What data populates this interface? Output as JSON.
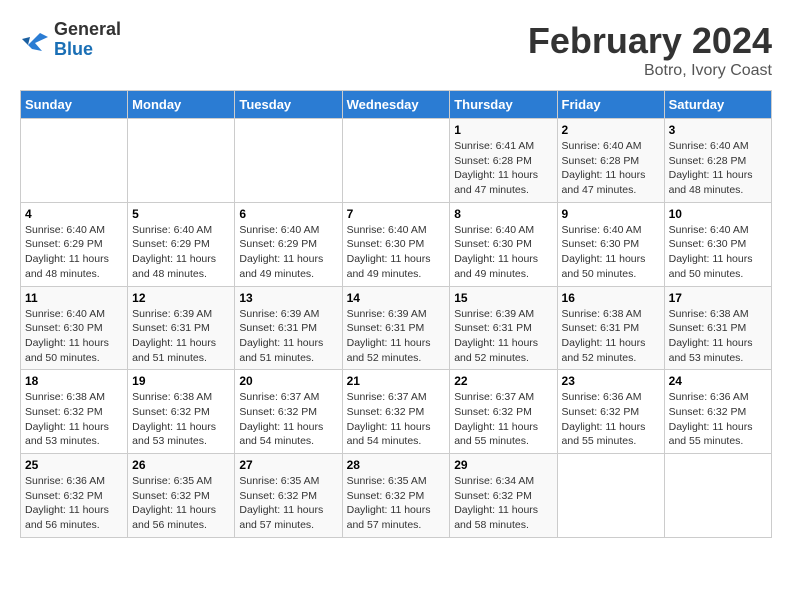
{
  "header": {
    "logo_general": "General",
    "logo_blue": "Blue",
    "title": "February 2024",
    "subtitle": "Botro, Ivory Coast"
  },
  "calendar": {
    "days_of_week": [
      "Sunday",
      "Monday",
      "Tuesday",
      "Wednesday",
      "Thursday",
      "Friday",
      "Saturday"
    ],
    "weeks": [
      [
        {
          "day": "",
          "info": ""
        },
        {
          "day": "",
          "info": ""
        },
        {
          "day": "",
          "info": ""
        },
        {
          "day": "",
          "info": ""
        },
        {
          "day": "1",
          "info": "Sunrise: 6:41 AM\nSunset: 6:28 PM\nDaylight: 11 hours and 47 minutes."
        },
        {
          "day": "2",
          "info": "Sunrise: 6:40 AM\nSunset: 6:28 PM\nDaylight: 11 hours and 47 minutes."
        },
        {
          "day": "3",
          "info": "Sunrise: 6:40 AM\nSunset: 6:28 PM\nDaylight: 11 hours and 48 minutes."
        }
      ],
      [
        {
          "day": "4",
          "info": "Sunrise: 6:40 AM\nSunset: 6:29 PM\nDaylight: 11 hours and 48 minutes."
        },
        {
          "day": "5",
          "info": "Sunrise: 6:40 AM\nSunset: 6:29 PM\nDaylight: 11 hours and 48 minutes."
        },
        {
          "day": "6",
          "info": "Sunrise: 6:40 AM\nSunset: 6:29 PM\nDaylight: 11 hours and 49 minutes."
        },
        {
          "day": "7",
          "info": "Sunrise: 6:40 AM\nSunset: 6:30 PM\nDaylight: 11 hours and 49 minutes."
        },
        {
          "day": "8",
          "info": "Sunrise: 6:40 AM\nSunset: 6:30 PM\nDaylight: 11 hours and 49 minutes."
        },
        {
          "day": "9",
          "info": "Sunrise: 6:40 AM\nSunset: 6:30 PM\nDaylight: 11 hours and 50 minutes."
        },
        {
          "day": "10",
          "info": "Sunrise: 6:40 AM\nSunset: 6:30 PM\nDaylight: 11 hours and 50 minutes."
        }
      ],
      [
        {
          "day": "11",
          "info": "Sunrise: 6:40 AM\nSunset: 6:30 PM\nDaylight: 11 hours and 50 minutes."
        },
        {
          "day": "12",
          "info": "Sunrise: 6:39 AM\nSunset: 6:31 PM\nDaylight: 11 hours and 51 minutes."
        },
        {
          "day": "13",
          "info": "Sunrise: 6:39 AM\nSunset: 6:31 PM\nDaylight: 11 hours and 51 minutes."
        },
        {
          "day": "14",
          "info": "Sunrise: 6:39 AM\nSunset: 6:31 PM\nDaylight: 11 hours and 52 minutes."
        },
        {
          "day": "15",
          "info": "Sunrise: 6:39 AM\nSunset: 6:31 PM\nDaylight: 11 hours and 52 minutes."
        },
        {
          "day": "16",
          "info": "Sunrise: 6:38 AM\nSunset: 6:31 PM\nDaylight: 11 hours and 52 minutes."
        },
        {
          "day": "17",
          "info": "Sunrise: 6:38 AM\nSunset: 6:31 PM\nDaylight: 11 hours and 53 minutes."
        }
      ],
      [
        {
          "day": "18",
          "info": "Sunrise: 6:38 AM\nSunset: 6:32 PM\nDaylight: 11 hours and 53 minutes."
        },
        {
          "day": "19",
          "info": "Sunrise: 6:38 AM\nSunset: 6:32 PM\nDaylight: 11 hours and 53 minutes."
        },
        {
          "day": "20",
          "info": "Sunrise: 6:37 AM\nSunset: 6:32 PM\nDaylight: 11 hours and 54 minutes."
        },
        {
          "day": "21",
          "info": "Sunrise: 6:37 AM\nSunset: 6:32 PM\nDaylight: 11 hours and 54 minutes."
        },
        {
          "day": "22",
          "info": "Sunrise: 6:37 AM\nSunset: 6:32 PM\nDaylight: 11 hours and 55 minutes."
        },
        {
          "day": "23",
          "info": "Sunrise: 6:36 AM\nSunset: 6:32 PM\nDaylight: 11 hours and 55 minutes."
        },
        {
          "day": "24",
          "info": "Sunrise: 6:36 AM\nSunset: 6:32 PM\nDaylight: 11 hours and 55 minutes."
        }
      ],
      [
        {
          "day": "25",
          "info": "Sunrise: 6:36 AM\nSunset: 6:32 PM\nDaylight: 11 hours and 56 minutes."
        },
        {
          "day": "26",
          "info": "Sunrise: 6:35 AM\nSunset: 6:32 PM\nDaylight: 11 hours and 56 minutes."
        },
        {
          "day": "27",
          "info": "Sunrise: 6:35 AM\nSunset: 6:32 PM\nDaylight: 11 hours and 57 minutes."
        },
        {
          "day": "28",
          "info": "Sunrise: 6:35 AM\nSunset: 6:32 PM\nDaylight: 11 hours and 57 minutes."
        },
        {
          "day": "29",
          "info": "Sunrise: 6:34 AM\nSunset: 6:32 PM\nDaylight: 11 hours and 58 minutes."
        },
        {
          "day": "",
          "info": ""
        },
        {
          "day": "",
          "info": ""
        }
      ]
    ]
  }
}
